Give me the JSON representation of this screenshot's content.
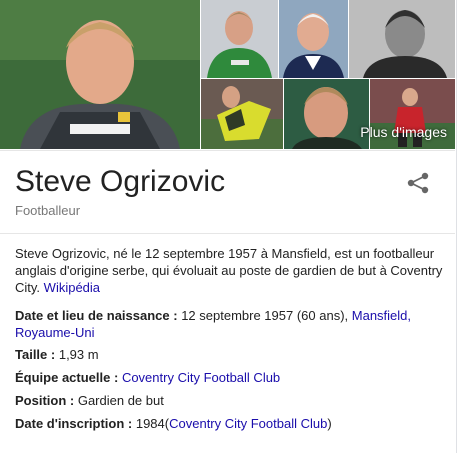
{
  "images": {
    "more_label": "Plus d'images",
    "tiles": [
      {
        "name": "photo-goalkeeper-grey-kit"
      },
      {
        "name": "photo-goalkeeper-green-kit"
      },
      {
        "name": "photo-smiling-white-shirt"
      },
      {
        "name": "photo-black-and-white"
      },
      {
        "name": "photo-yellow-jersey-action"
      },
      {
        "name": "photo-portrait-close-up"
      },
      {
        "name": "photo-red-kit-pitch"
      }
    ]
  },
  "entity": {
    "name": "Steve Ogrizovic",
    "type": "Footballeur",
    "share_icon": "share-icon"
  },
  "description": {
    "text": "Steve Ogrizovic, né le 12 septembre 1957 à Mansfield, est un footballeur anglais d'origine serbe, qui évoluait au poste de gardien de but à Coventry City.",
    "source_link": "Wikipédia"
  },
  "facts": {
    "birth": {
      "label": "Date et lieu de naissance :",
      "value": "12 septembre 1957 (60 ans),",
      "link": "Mansfield, Royaume-Uni"
    },
    "height": {
      "label": "Taille :",
      "value": "1,93 m"
    },
    "team": {
      "label": "Équipe actuelle :",
      "link": "Coventry City Football Club"
    },
    "position": {
      "label": "Position :",
      "value": "Gardien de but"
    },
    "joined": {
      "label": "Date d'inscription :",
      "value": "1984",
      "open_paren": "(",
      "link": "Coventry City Football Club",
      "close_paren": ")"
    }
  },
  "colors": {
    "link": "#1a0dab",
    "subtitle": "#777777",
    "divider": "#e6e6e6"
  }
}
